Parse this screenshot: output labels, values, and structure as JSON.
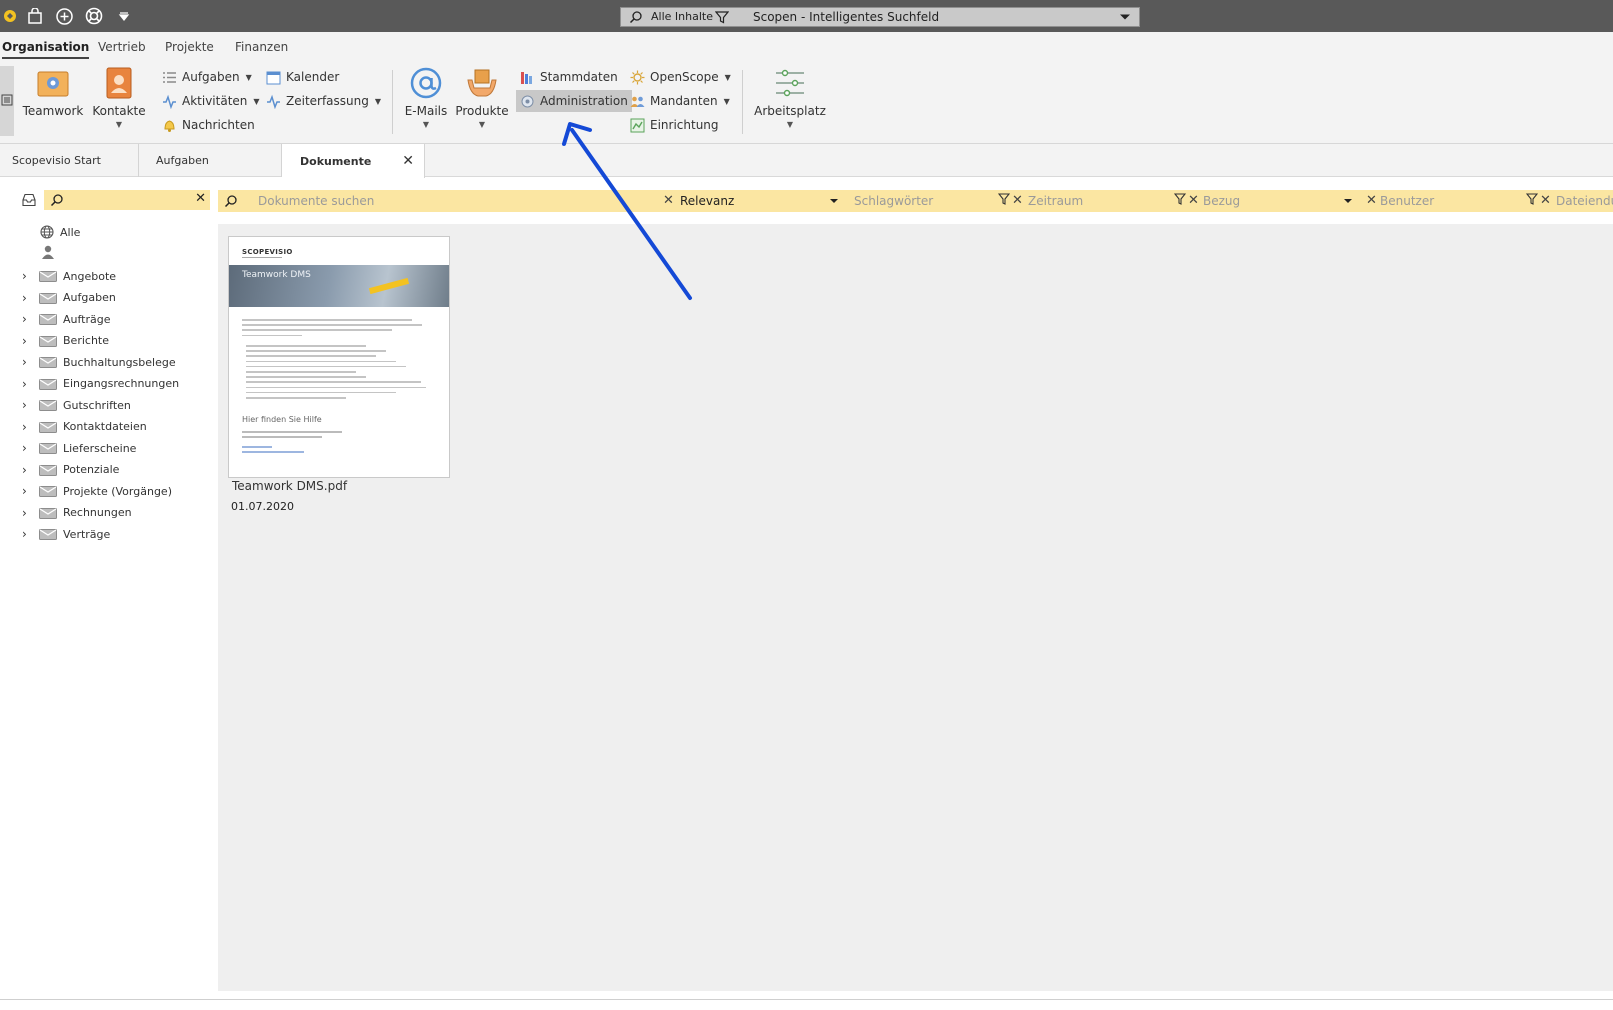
{
  "titlebar": {
    "search_scope": "Alle Inhalte",
    "search_title": "Scopen - Intelligentes Suchfeld",
    "icons": [
      "app-logo-icon",
      "shopping-bag-icon",
      "plus-circle-icon",
      "lifebuoy-icon",
      "dropdown-icon"
    ]
  },
  "ribbon_tabs": [
    "Organisation",
    "Vertrieb",
    "Projekte",
    "Finanzen"
  ],
  "ribbon": {
    "teamwork": "Teamwork",
    "kontakte": "Kontakte",
    "aufgaben": "Aufgaben",
    "aktivitaeten": "Aktivitäten",
    "nachrichten": "Nachrichten",
    "kalender": "Kalender",
    "zeiterfassung": "Zeiterfassung",
    "emails": "E-Mails",
    "produkte": "Produkte",
    "stammdaten": "Stammdaten",
    "administration": "Administration",
    "openscope": "OpenScope",
    "mandanten": "Mandanten",
    "einrichtung": "Einrichtung",
    "arbeitsplatz": "Arbeitsplatz"
  },
  "doc_tabs": {
    "start": "Scopevisio Start",
    "aufgaben": "Aufgaben",
    "dokumente": "Dokumente",
    "close_symbol": "✕"
  },
  "left_tree": {
    "all": "Alle",
    "items": [
      "Angebote",
      "Aufgaben",
      "Aufträge",
      "Berichte",
      "Buchhaltungsbelege",
      "Eingangsrechnungen",
      "Gutschriften",
      "Kontaktdateien",
      "Lieferscheine",
      "Potenziale",
      "Projekte (Vorgänge)",
      "Rechnungen",
      "Verträge"
    ]
  },
  "filter_bar": {
    "search_placeholder": "Dokumente suchen",
    "relevanz": "Relevanz",
    "schlagwoerter": "Schlagwörter",
    "zeitraum": "Zeitraum",
    "bezug": "Bezug",
    "benutzer": "Benutzer",
    "dateiendung": "Dateiendu"
  },
  "document": {
    "name": "Teamwork DMS.pdf",
    "date": "01.07.2020",
    "thumb_brand": "SCOPEVISIO",
    "thumb_title": "Teamwork DMS",
    "thumb_help": "Hier finden Sie Hilfe"
  },
  "colors": {
    "titlebar": "#595959",
    "filter_yellow": "#fbe6a2",
    "content_bg": "#efefef",
    "arrow_blue": "#1449d6"
  }
}
